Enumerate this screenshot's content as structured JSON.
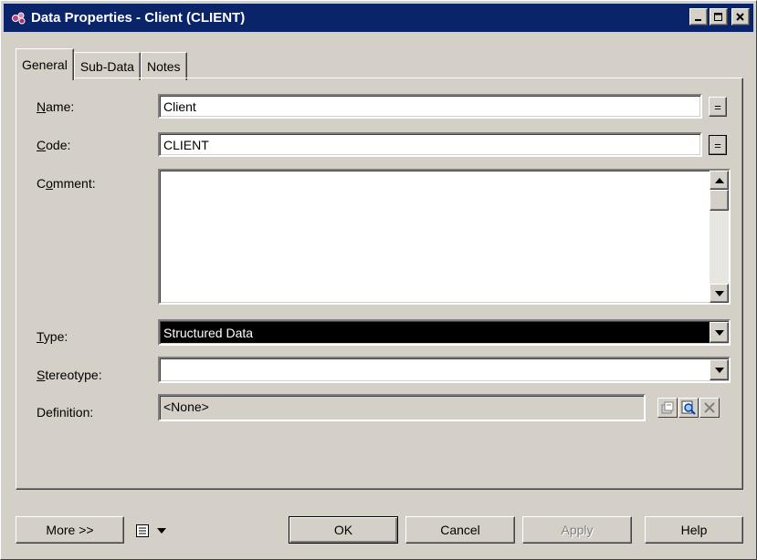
{
  "window": {
    "title": "Data Properties - Client (CLIENT)",
    "controls": {
      "minimize": "_",
      "maximize": "□",
      "close": "×"
    }
  },
  "tabs": [
    {
      "label": "General",
      "active": true
    },
    {
      "label": "Sub-Data",
      "active": false
    },
    {
      "label": "Notes",
      "active": false
    }
  ],
  "form": {
    "name_label_ul": "N",
    "name_label_rest": "ame:",
    "name_value": "Client",
    "code_label_ul": "C",
    "code_label_rest": "ode:",
    "code_value": "CLIENT",
    "comment_label_pre": "C",
    "comment_label_ul": "o",
    "comment_label_rest": "mment:",
    "comment_value": "",
    "type_label_ul": "T",
    "type_label_rest": "ype:",
    "type_value": "Structured Data",
    "stereotype_label_ul": "S",
    "stereotype_label_rest": "tereotype:",
    "stereotype_value": "",
    "definition_label": "Definition:",
    "definition_value": "<None>",
    "equal_button": "="
  },
  "footer": {
    "more_label": "More >>",
    "ok_label": "OK",
    "cancel_label": "Cancel",
    "apply_label": "Apply",
    "help_label": "Help"
  },
  "icons": {
    "title": "data-entity-icon",
    "properties": "properties-icon",
    "search": "search-icon",
    "clear": "clear-icon",
    "menu": "property-sheet-menu-icon"
  }
}
